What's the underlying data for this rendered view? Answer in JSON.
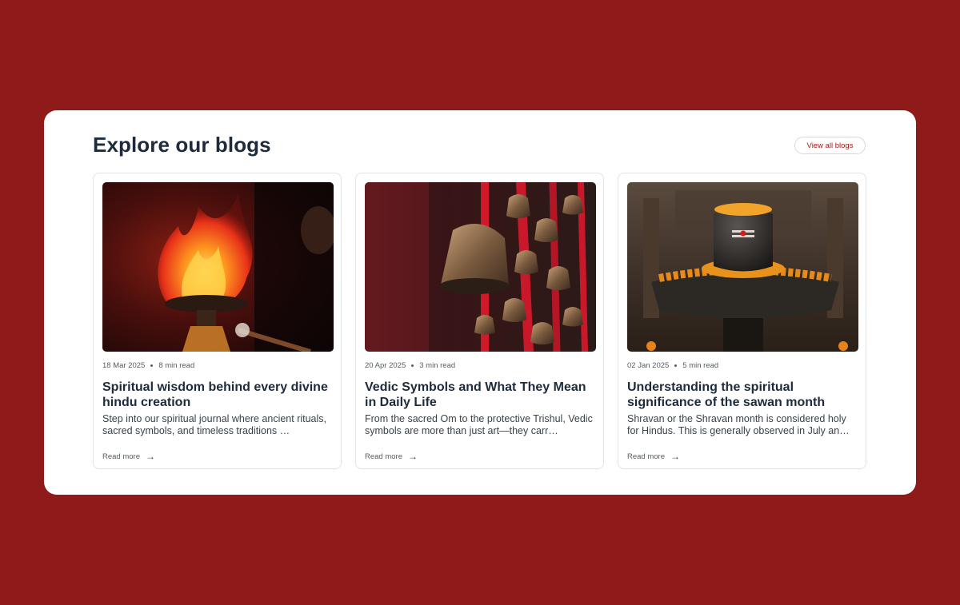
{
  "section": {
    "title": "Explore our blogs",
    "view_all_label": "View all blogs"
  },
  "colors": {
    "background": "#8f1a1a",
    "panel": "#ffffff",
    "accent": "#a11a1a",
    "heading": "#1e2b3c"
  },
  "posts": [
    {
      "date": "18 Mar 2025",
      "read_time": "8 min read",
      "title": "Spiritual wisdom behind every divine hindu creation",
      "excerpt": "Step into our spiritual journal where ancient rituals, sacred symbols, and timeless traditions …",
      "read_more": "Read more",
      "image": "aarti-fire-photo"
    },
    {
      "date": "20 Apr 2025",
      "read_time": "3 min read",
      "title": "Vedic Symbols and What They Mean in Daily Life",
      "excerpt": "From the sacred Om to the protective Trishul, Vedic symbols are more than just art—they carr…",
      "read_more": "Read more",
      "image": "temple-bells-photo"
    },
    {
      "date": "02 Jan 2025",
      "read_time": "5 min read",
      "title": "Understanding the spiritual significance of the sawan month",
      "excerpt": "Shravan or the Shravan month is considered holy for Hindus. This is generally observed in July an…",
      "read_more": "Read more",
      "image": "shivling-photo"
    }
  ]
}
